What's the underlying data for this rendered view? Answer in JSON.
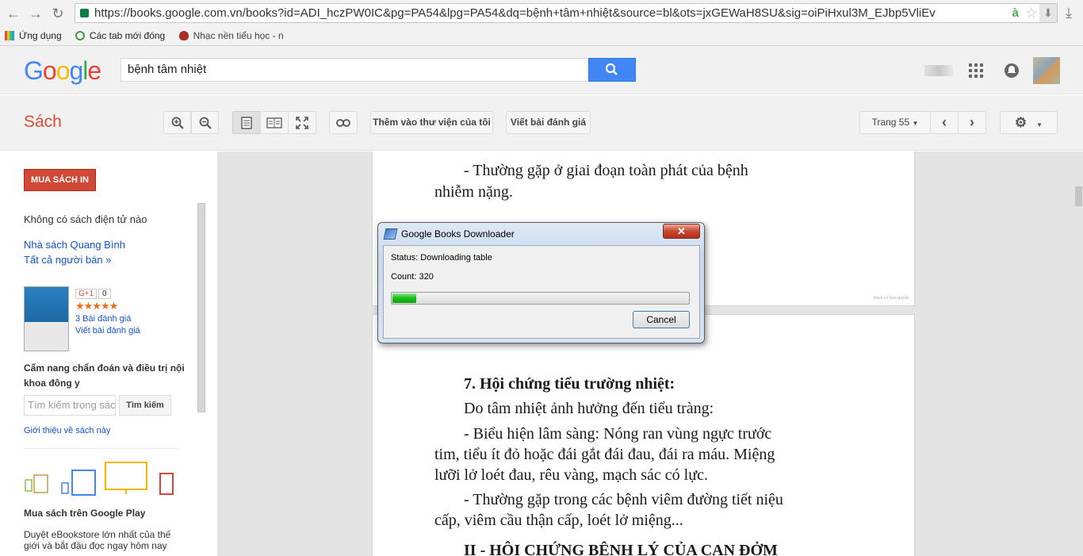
{
  "browser": {
    "url": "https://books.google.com.vn/books?id=ADI_hczPW0IC&pg=PA54&lpg=PA54&dq=bệnh+tâm+nhiệt&source=bl&ots=jxGEWaH8SU&sig=oiPiHxul3M_EJbp5VliEv",
    "bookmarks": [
      "Ứng dụng",
      "Các tab mới đóng",
      "Nhạc nền tiểu học - n"
    ],
    "omnibox_extension": "à"
  },
  "header": {
    "logo": "Google",
    "search_value": "bệnh tâm nhiệt"
  },
  "toolbar": {
    "section": "Sách",
    "add_library": "Thêm vào thư viện của tôi",
    "write_review": "Viết bài đánh giá",
    "page_label": "Trang 55"
  },
  "sidebar": {
    "buy_button": "MUA SÁCH IN",
    "no_ebook": "Không có sách điện tử nào",
    "seller": "Nhà sách Quang Bình",
    "all_sellers": "Tất cả người bán »",
    "gplus": "G+1",
    "gplus_count": "0",
    "stars": "★★★★★",
    "review_count": "3 Bài đánh giá",
    "write_review": "Viết bài đánh giá",
    "book_title": "Cẩm nang chẩn đoán và điều trị nội khoa đông y",
    "search_placeholder": "Tìm kiếm trong sác",
    "search_button": "Tìm kiếm",
    "about_book": "Giới thiệu về sách này",
    "play_heading": "Mua sách trên Google Play",
    "play_text": "Duyệt eBookstore lớn nhất của thế giới và bắt đầu đọc ngay hôm nay"
  },
  "book_page_1": {
    "line1": "- Thường gặp ở giai đoạn toàn phát của bệnh",
    "line2": "nhiễm nặng.",
    "watermark": "Sách có bản quyền"
  },
  "book_page_2": {
    "heading": "7. Hội chứng tiểu trường nhiệt:",
    "line1": "Do tâm nhiệt ảnh hưởng đến tiểu tràng:",
    "line2": "- Biểu hiện lâm sàng: Nóng ran vùng ngực trước",
    "line3": "tim, tiểu ít đỏ hoặc đái gắt đái đau, đái ra máu. Miệng",
    "line4": "lưỡi lở loét đau, rêu vàng, mạch sác có lực.",
    "line5": "- Thường gặp trong các bệnh viêm đường tiết niệu",
    "line6": "cấp, viêm cầu thận cấp, loét lở miệng...",
    "line7": "II - HỘI CHỨNG BỆNH LÝ CỦA CAN ĐỞM"
  },
  "dialog": {
    "title": "Google Books Downloader",
    "status": "Status: Downloading table",
    "count": "Count: 320",
    "progress": 0.08,
    "cancel": "Cancel",
    "close": "✕"
  }
}
